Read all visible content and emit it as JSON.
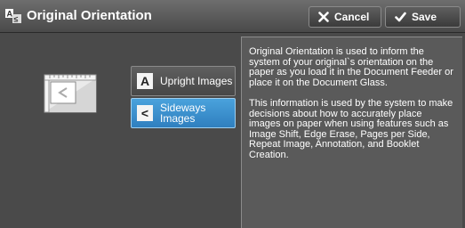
{
  "header": {
    "title": "Original Orientation",
    "cancel_label": "Cancel",
    "save_label": "Save"
  },
  "options": [
    {
      "label": "Upright Images",
      "selected": false,
      "icon": "A"
    },
    {
      "label": "Sideways Images",
      "selected": true,
      "icon": "<"
    }
  ],
  "info": {
    "paragraph1": "Original Orientation is used to inform the system of your original`s orientation on the paper as you load it in the Document Feeder or place it on the Document Glass.",
    "paragraph2": "This information is used by the system to make decisions about how to accurately place images on paper when using features such as Image Shift, Edge Erase, Pages per Side, Repeat Image, Annotation, and Booklet Creation."
  },
  "colors": {
    "selected": "#3a8fd0",
    "background": "#4a4a4a"
  }
}
